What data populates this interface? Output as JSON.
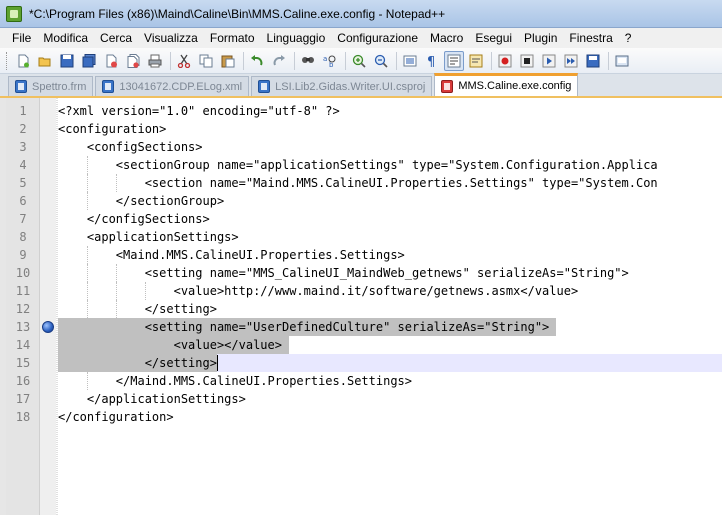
{
  "window": {
    "title": "*C:\\Program Files (x86)\\Maind\\Caline\\Bin\\MMS.Caline.exe.config - Notepad++"
  },
  "menu": [
    "File",
    "Modifica",
    "Cerca",
    "Visualizza",
    "Formato",
    "Linguaggio",
    "Configurazione",
    "Macro",
    "Esegui",
    "Plugin",
    "Finestra",
    "?"
  ],
  "toolbar": {
    "icons": [
      "new-file-icon",
      "open-file-icon",
      "save-icon",
      "save-all-icon",
      "close-icon",
      "close-all-icon",
      "print-icon",
      "cut-icon",
      "copy-icon",
      "paste-icon",
      "undo-icon",
      "redo-icon",
      "find-icon",
      "replace-icon",
      "zoom-in-icon",
      "zoom-out-icon",
      "sync-vertical-icon",
      "sync-horizontal-icon",
      "word-wrap-icon",
      "show-all-chars-icon",
      "indent-guide-icon",
      "user-lang-icon",
      "record-macro-icon",
      "stop-macro-icon",
      "play-macro-icon",
      "run-macro-multiple-icon",
      "save-macro-icon",
      "launch-icon"
    ]
  },
  "tabs": [
    {
      "label": "Spettro.frm",
      "icon": "blue",
      "active": false
    },
    {
      "label": "13041672.CDP.ELog.xml",
      "icon": "blue",
      "active": false
    },
    {
      "label": "LSI.Lib2.Gidas.Writer.UI.csproj",
      "icon": "blue",
      "active": false
    },
    {
      "label": "MMS.Caline.exe.config",
      "icon": "red",
      "active": true
    }
  ],
  "editor": {
    "bookmark_line": 13,
    "selected_lines": [
      13,
      14,
      15
    ],
    "lines": [
      {
        "n": "1",
        "text": "<?xml version=\"1.0\" encoding=\"utf-8\" ?>"
      },
      {
        "n": "2",
        "text": "<configuration>"
      },
      {
        "n": "3",
        "text": "    <configSections>"
      },
      {
        "n": "4",
        "text": "        <sectionGroup name=\"applicationSettings\" type=\"System.Configuration.Applica"
      },
      {
        "n": "5",
        "text": "            <section name=\"Maind.MMS.CalineUI.Properties.Settings\" type=\"System.Con"
      },
      {
        "n": "6",
        "text": "        </sectionGroup>"
      },
      {
        "n": "7",
        "text": "    </configSections>"
      },
      {
        "n": "8",
        "text": "    <applicationSettings>"
      },
      {
        "n": "9",
        "text": "        <Maind.MMS.CalineUI.Properties.Settings>"
      },
      {
        "n": "10",
        "text": "            <setting name=\"MMS_CalineUI_MaindWeb_getnews\" serializeAs=\"String\">"
      },
      {
        "n": "11",
        "text": "                <value>http://www.maind.it/software/getnews.asmx</value>"
      },
      {
        "n": "12",
        "text": "            </setting>"
      },
      {
        "n": "13",
        "text": "            <setting name=\"UserDefinedCulture\" serializeAs=\"String\">"
      },
      {
        "n": "14",
        "text": "                <value></value>"
      },
      {
        "n": "15",
        "text": "            </setting>"
      },
      {
        "n": "16",
        "text": "        </Maind.MMS.CalineUI.Properties.Settings>"
      },
      {
        "n": "17",
        "text": "    </applicationSettings>"
      },
      {
        "n": "18",
        "text": "</configuration>"
      }
    ]
  }
}
